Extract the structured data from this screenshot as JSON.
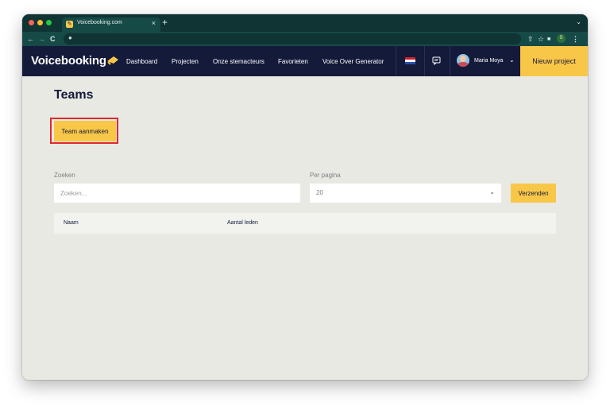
{
  "browser": {
    "tab_title": "Voicebooking.com",
    "tab_close": "×",
    "new_tab": "+",
    "tab_menu": "⌄",
    "nav_back": "←",
    "nav_forward": "→",
    "nav_reload": "C",
    "profile_initial": "S"
  },
  "site": {
    "logo_text": "Voicebooking",
    "nav_items": [
      {
        "label": "Dashboard"
      },
      {
        "label": "Projecten"
      },
      {
        "label": "Onze stemacteurs"
      },
      {
        "label": "Favorieten"
      },
      {
        "label": "Voice Over Generator"
      }
    ],
    "user_name": "Maria Moya",
    "new_project_label": "Nieuw project"
  },
  "main": {
    "title": "Teams",
    "create_team_label": "Team aanmaken",
    "search_label": "Zoeken",
    "search_placeholder": "Zoeken...",
    "per_page_label": "Per pagina",
    "per_page_value": "20",
    "submit_label": "Verzenden",
    "table_columns": [
      "Naam",
      "Aantal leden"
    ]
  },
  "colors": {
    "brand_navy": "#141a3a",
    "accent_yellow": "#f9c748",
    "browser_green": "#164a47",
    "highlight_red": "#e2282b"
  }
}
